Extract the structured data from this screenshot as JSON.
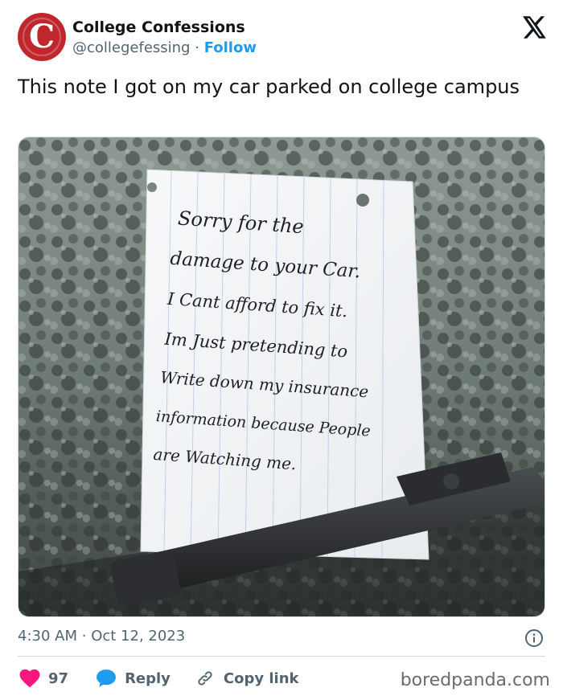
{
  "account": {
    "avatar_letter": "C",
    "name": "College Confessions",
    "handle": "@collegefessing",
    "separator": "·",
    "follow_label": "Follow"
  },
  "icons": {
    "logo": "x-logo-icon",
    "info": "info-icon",
    "like": "heart-icon",
    "reply": "speech-bubble-icon",
    "copy": "link-icon"
  },
  "tweet": {
    "text": "This note I got on my car parked on college campus"
  },
  "media": {
    "note_lines": [
      "Sorry for the",
      "damage to your Car.",
      "I Cant afford to fix it.",
      "Im Just pretending to",
      "Write down my insurance",
      "information because People",
      "are Watching me."
    ]
  },
  "meta": {
    "time": "4:30 AM",
    "separator": "·",
    "date": "Oct 12, 2023"
  },
  "actions": {
    "like_count": "97",
    "reply_label": "Reply",
    "copy_label": "Copy link"
  },
  "watermark": "boredpanda.com",
  "colors": {
    "brand_red": "#c0272d",
    "link_blue": "#1d9bf0",
    "like_red": "#f91880",
    "muted_gray": "#536471"
  }
}
